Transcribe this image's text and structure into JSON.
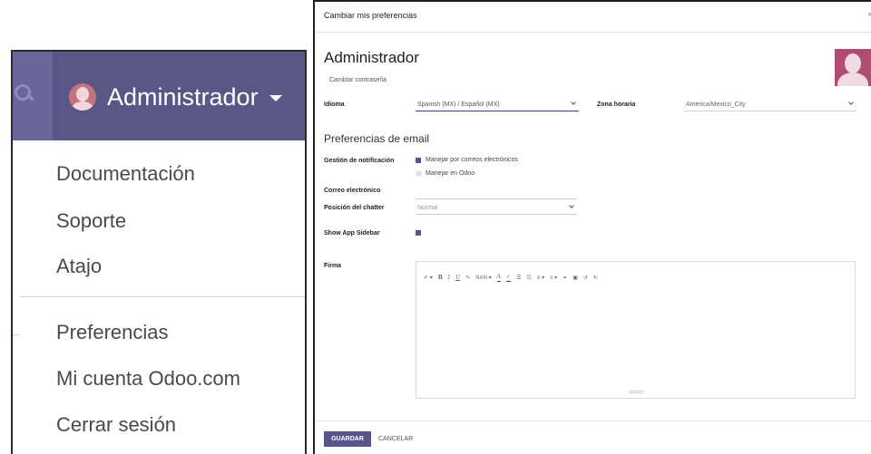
{
  "user_menu": {
    "name": "Administrador",
    "dropdown": {
      "group1": [
        "Documentación",
        "Soporte",
        "Atajo"
      ],
      "group2": [
        "Preferencias",
        "Mi cuenta Odoo.com",
        "Cerrar sesión"
      ]
    }
  },
  "modal": {
    "title": "Cambiar mis preferencias",
    "close_glyph": "×",
    "user_name": "Administrador",
    "change_password": "Cambiar contraseña",
    "language": {
      "label": "Idioma",
      "value": "Spanish (MX) / Español (MX)"
    },
    "timezone": {
      "label": "Zona horaria",
      "value": "America/Mexico_City"
    },
    "email_prefs_title": "Preferencias de email",
    "notification": {
      "label": "Gestión de notificación",
      "options": [
        "Manejar por correos electrónicos",
        "Manejar en Odoo"
      ],
      "selected": 0
    },
    "email_label": "Correo electrónico",
    "chatter": {
      "label": "Posición del chatter",
      "value": "Normal"
    },
    "sidebar": {
      "label": "Show App Sidebar",
      "checked": true
    },
    "signature_label": "Firma",
    "editor_toolbar": {
      "paint": "✐ ▾",
      "bold": "B",
      "italic": "I",
      "underline": "U",
      "eraser": "✎",
      "font_size": "NAN ▾",
      "font_color": "A",
      "highlight": "✓",
      "ul": "☰",
      "ol": "☷",
      "align": "≡ ▾",
      "paragraph": "≡ ▾",
      "link": "⚭",
      "image": "▣",
      "undo": "↺",
      "redo": "↻"
    },
    "save_label": "GUARDAR",
    "cancel_label": "CANCELAR"
  },
  "colors": {
    "navbar": "#5a5787",
    "primary": "#58558d",
    "avatar": "#b04b73"
  }
}
